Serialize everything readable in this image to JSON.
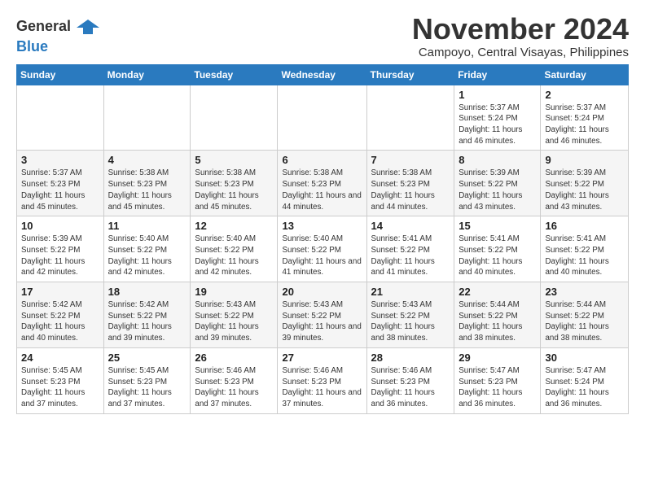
{
  "logo": {
    "general": "General",
    "blue": "Blue"
  },
  "title": "November 2024",
  "subtitle": "Campoyo, Central Visayas, Philippines",
  "weekdays": [
    "Sunday",
    "Monday",
    "Tuesday",
    "Wednesday",
    "Thursday",
    "Friday",
    "Saturday"
  ],
  "weeks": [
    [
      {
        "day": "",
        "info": ""
      },
      {
        "day": "",
        "info": ""
      },
      {
        "day": "",
        "info": ""
      },
      {
        "day": "",
        "info": ""
      },
      {
        "day": "",
        "info": ""
      },
      {
        "day": "1",
        "info": "Sunrise: 5:37 AM\nSunset: 5:24 PM\nDaylight: 11 hours and 46 minutes."
      },
      {
        "day": "2",
        "info": "Sunrise: 5:37 AM\nSunset: 5:24 PM\nDaylight: 11 hours and 46 minutes."
      }
    ],
    [
      {
        "day": "3",
        "info": "Sunrise: 5:37 AM\nSunset: 5:23 PM\nDaylight: 11 hours and 45 minutes."
      },
      {
        "day": "4",
        "info": "Sunrise: 5:38 AM\nSunset: 5:23 PM\nDaylight: 11 hours and 45 minutes."
      },
      {
        "day": "5",
        "info": "Sunrise: 5:38 AM\nSunset: 5:23 PM\nDaylight: 11 hours and 45 minutes."
      },
      {
        "day": "6",
        "info": "Sunrise: 5:38 AM\nSunset: 5:23 PM\nDaylight: 11 hours and 44 minutes."
      },
      {
        "day": "7",
        "info": "Sunrise: 5:38 AM\nSunset: 5:23 PM\nDaylight: 11 hours and 44 minutes."
      },
      {
        "day": "8",
        "info": "Sunrise: 5:39 AM\nSunset: 5:22 PM\nDaylight: 11 hours and 43 minutes."
      },
      {
        "day": "9",
        "info": "Sunrise: 5:39 AM\nSunset: 5:22 PM\nDaylight: 11 hours and 43 minutes."
      }
    ],
    [
      {
        "day": "10",
        "info": "Sunrise: 5:39 AM\nSunset: 5:22 PM\nDaylight: 11 hours and 42 minutes."
      },
      {
        "day": "11",
        "info": "Sunrise: 5:40 AM\nSunset: 5:22 PM\nDaylight: 11 hours and 42 minutes."
      },
      {
        "day": "12",
        "info": "Sunrise: 5:40 AM\nSunset: 5:22 PM\nDaylight: 11 hours and 42 minutes."
      },
      {
        "day": "13",
        "info": "Sunrise: 5:40 AM\nSunset: 5:22 PM\nDaylight: 11 hours and 41 minutes."
      },
      {
        "day": "14",
        "info": "Sunrise: 5:41 AM\nSunset: 5:22 PM\nDaylight: 11 hours and 41 minutes."
      },
      {
        "day": "15",
        "info": "Sunrise: 5:41 AM\nSunset: 5:22 PM\nDaylight: 11 hours and 40 minutes."
      },
      {
        "day": "16",
        "info": "Sunrise: 5:41 AM\nSunset: 5:22 PM\nDaylight: 11 hours and 40 minutes."
      }
    ],
    [
      {
        "day": "17",
        "info": "Sunrise: 5:42 AM\nSunset: 5:22 PM\nDaylight: 11 hours and 40 minutes."
      },
      {
        "day": "18",
        "info": "Sunrise: 5:42 AM\nSunset: 5:22 PM\nDaylight: 11 hours and 39 minutes."
      },
      {
        "day": "19",
        "info": "Sunrise: 5:43 AM\nSunset: 5:22 PM\nDaylight: 11 hours and 39 minutes."
      },
      {
        "day": "20",
        "info": "Sunrise: 5:43 AM\nSunset: 5:22 PM\nDaylight: 11 hours and 39 minutes."
      },
      {
        "day": "21",
        "info": "Sunrise: 5:43 AM\nSunset: 5:22 PM\nDaylight: 11 hours and 38 minutes."
      },
      {
        "day": "22",
        "info": "Sunrise: 5:44 AM\nSunset: 5:22 PM\nDaylight: 11 hours and 38 minutes."
      },
      {
        "day": "23",
        "info": "Sunrise: 5:44 AM\nSunset: 5:22 PM\nDaylight: 11 hours and 38 minutes."
      }
    ],
    [
      {
        "day": "24",
        "info": "Sunrise: 5:45 AM\nSunset: 5:23 PM\nDaylight: 11 hours and 37 minutes."
      },
      {
        "day": "25",
        "info": "Sunrise: 5:45 AM\nSunset: 5:23 PM\nDaylight: 11 hours and 37 minutes."
      },
      {
        "day": "26",
        "info": "Sunrise: 5:46 AM\nSunset: 5:23 PM\nDaylight: 11 hours and 37 minutes."
      },
      {
        "day": "27",
        "info": "Sunrise: 5:46 AM\nSunset: 5:23 PM\nDaylight: 11 hours and 37 minutes."
      },
      {
        "day": "28",
        "info": "Sunrise: 5:46 AM\nSunset: 5:23 PM\nDaylight: 11 hours and 36 minutes."
      },
      {
        "day": "29",
        "info": "Sunrise: 5:47 AM\nSunset: 5:23 PM\nDaylight: 11 hours and 36 minutes."
      },
      {
        "day": "30",
        "info": "Sunrise: 5:47 AM\nSunset: 5:24 PM\nDaylight: 11 hours and 36 minutes."
      }
    ]
  ]
}
